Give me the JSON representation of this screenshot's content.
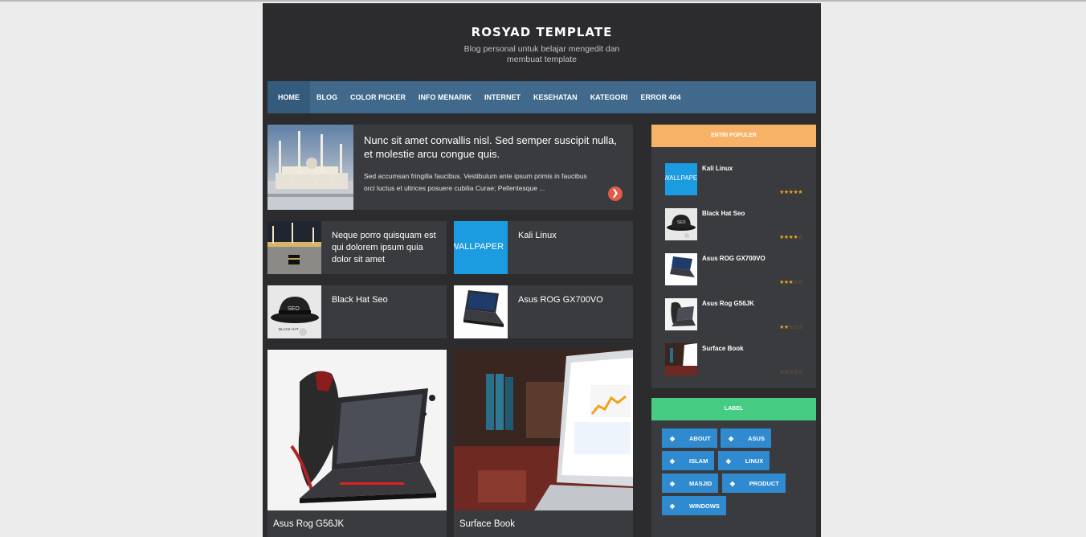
{
  "header": {
    "title": "ROSYAD TEMPLATE",
    "description": "Blog personal untuk belajar mengedit dan membuat template"
  },
  "nav": {
    "items": [
      {
        "label": "HOME",
        "active": true
      },
      {
        "label": "BLOG"
      },
      {
        "label": "COLOR PICKER"
      },
      {
        "label": "INFO MENARIK"
      },
      {
        "label": "INTERNET"
      },
      {
        "label": "KESEHATAN"
      },
      {
        "label": "KATEGORI"
      },
      {
        "label": "ERROR 404"
      }
    ]
  },
  "featured": {
    "title": "Nunc sit amet convallis nisl. Sed semper suscipit nulla, et molestie arcu congue quis.",
    "excerpt": "Sed accumsan fringilla faucibus. Vestibulum ante ipsum primis in faucibus orci luctus et ultrices posuere cubilia Curae; Pellentesque ...",
    "more_icon": "chevron-right-icon"
  },
  "cards": [
    {
      "title": "Neque porro quisquam est qui dolorem ipsum quia dolor sit amet"
    },
    {
      "title": "Kali Linux",
      "thumb_text": "WALLPAPER"
    },
    {
      "title": "Black Hat Seo",
      "thumb_text": "SEO",
      "thumb_caption": "BLACK HAT"
    },
    {
      "title": "Asus ROG GX700VO"
    }
  ],
  "big_posts": [
    {
      "title": "Asus Rog G56JK"
    },
    {
      "title": "Surface Book"
    }
  ],
  "popular": {
    "heading": "ENTRI POPULER",
    "accent": "#f7b267",
    "items": [
      {
        "title": "Kali Linux",
        "rating": 5,
        "thumb_text": "WALLPAPER"
      },
      {
        "title": "Black Hat Seo",
        "rating": 4,
        "thumb_text": "SEO"
      },
      {
        "title": "Asus ROG GX700VO",
        "rating": 3
      },
      {
        "title": "Asus Rog G56JK",
        "rating": 2
      },
      {
        "title": "Surface Book",
        "rating": 0
      }
    ]
  },
  "labels": {
    "heading": "LABEL",
    "accent": "#45cc82",
    "tag_icon": "tag-icon",
    "items": [
      "ABOUT",
      "ASUS",
      "ISLAM",
      "LINUX",
      "MASJID",
      "PRODUCT",
      "WINDOWS"
    ]
  },
  "colors": {
    "page_bg": "#ececec",
    "wrap_bg": "#2c2c2f",
    "card_bg": "#3a3b3f",
    "nav_bg": "#40698c",
    "tag_bg": "#2f8ad0",
    "read_more": "#e35b48",
    "star": "#f0a21c"
  }
}
